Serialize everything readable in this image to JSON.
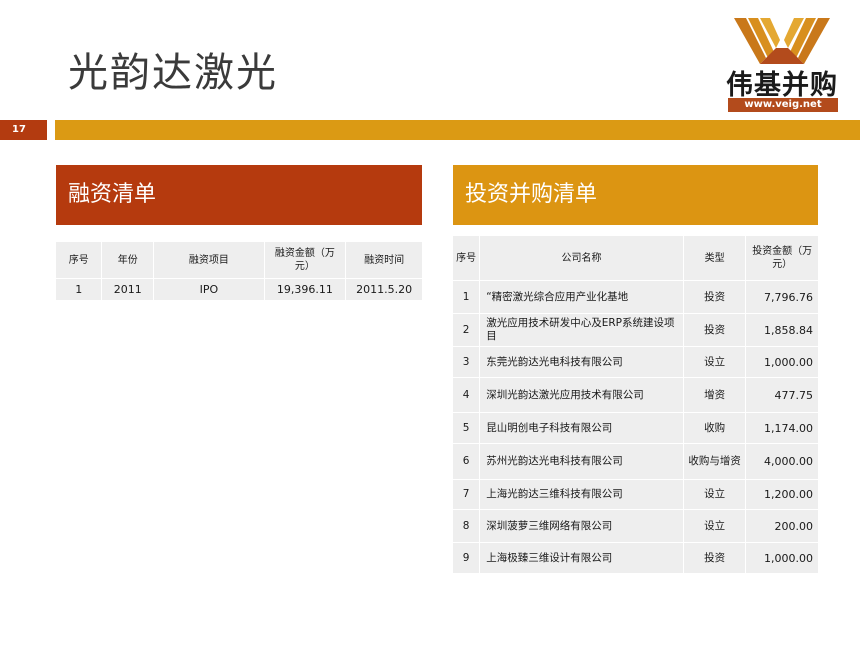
{
  "title": "光韵达激光",
  "logo": {
    "brand": "伟基并购",
    "url": "www.veig.net"
  },
  "page_number": "17",
  "left_section": {
    "heading": "融资清单",
    "headers": [
      "序号",
      "年份",
      "融资项目",
      "融资金额（万元）",
      "融资时间"
    ],
    "rows": [
      [
        "1",
        "2011",
        "IPO",
        "19,396.11",
        "2011.5.20"
      ]
    ]
  },
  "right_section": {
    "heading": "投资并购清单",
    "headers": [
      "序号",
      "公司名称",
      "类型",
      "投资金额（万元）"
    ],
    "rows": [
      [
        "1",
        "“精密激光综合应用产业化基地",
        "投资",
        "7,796.76"
      ],
      [
        "2",
        "激光应用技术研发中心及ERP系统建设项目",
        "投资",
        "1,858.84"
      ],
      [
        "3",
        "东莞光韵达光电科技有限公司",
        "设立",
        "1,000.00"
      ],
      [
        "4",
        "深圳光韵达激光应用技术有限公司",
        "增资",
        "477.75"
      ],
      [
        "5",
        "昆山明创电子科技有限公司",
        "收购",
        "1,174.00"
      ],
      [
        "6",
        "苏州光韵达光电科技有限公司",
        "收购与增资",
        "4,000.00"
      ],
      [
        "7",
        "上海光韵达三维科技有限公司",
        "设立",
        "1,200.00"
      ],
      [
        "8",
        "深圳菠萝三维网络有限公司",
        "设立",
        "200.00"
      ],
      [
        "9",
        "上海极臻三维设计有限公司",
        "投资",
        "1,000.00"
      ]
    ]
  },
  "colors": {
    "accent_red": "#b53a0e",
    "accent_orange": "#dc9512",
    "cell_bg": "#eeeeee"
  }
}
